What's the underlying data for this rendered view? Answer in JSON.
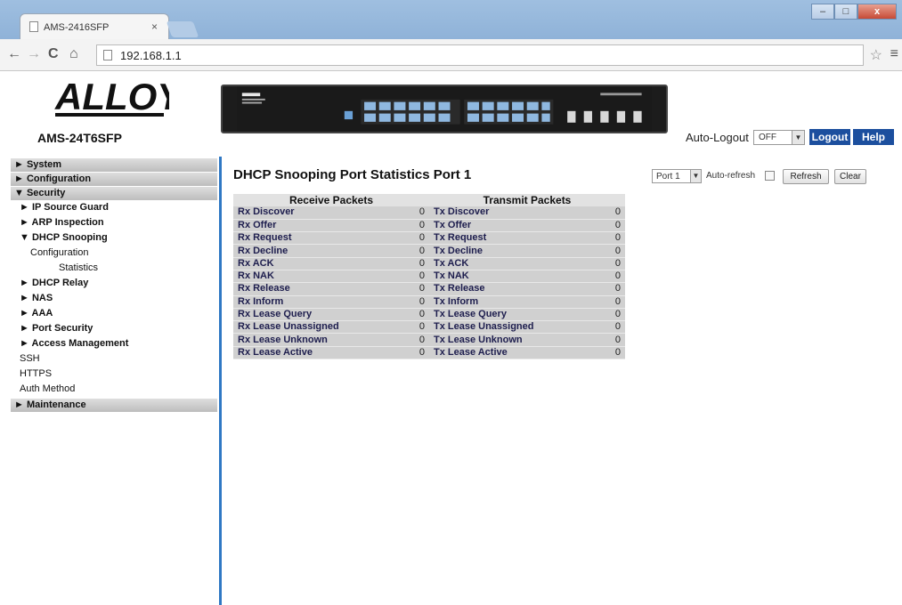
{
  "browser": {
    "tab_title": "AMS-2416SFP",
    "tab_close": "×",
    "address": "192.168.1.1",
    "nav_back": "←",
    "nav_forward": "→",
    "nav_reload": "C",
    "nav_home": "⌂",
    "star": "☆",
    "menu": "≡"
  },
  "header": {
    "logo_text": "ALLOY",
    "model": "AMS-24T6SFP",
    "auto_logout_label": "Auto-Logout",
    "auto_logout_value": "OFF",
    "logout_label": "Logout",
    "help_label": "Help"
  },
  "sidebar": {
    "system": "► System",
    "configuration": "► Configuration",
    "security": "▼ Security",
    "ip_source_guard": "► IP Source Guard",
    "arp_inspection": "► ARP Inspection",
    "dhcp_snooping": "▼ DHCP Snooping",
    "dhcp_configuration": "Configuration",
    "dhcp_statistics": "Statistics",
    "dhcp_relay": "► DHCP Relay",
    "nas": "► NAS",
    "aaa": "► AAA",
    "port_security": "► Port Security",
    "access_management": "► Access Management",
    "ssh": "SSH",
    "https": "HTTPS",
    "auth_method": "Auth Method",
    "maintenance": "► Maintenance"
  },
  "main": {
    "title": "DHCP Snooping Port Statistics  Port 1",
    "port_select": "Port 1",
    "auto_refresh_label": "Auto-refresh",
    "refresh_label": "Refresh",
    "clear_label": "Clear",
    "receive_header": "Receive Packets",
    "transmit_header": "Transmit Packets",
    "rows": [
      {
        "rx": "Rx Discover",
        "rxv": "0",
        "tx": "Tx Discover",
        "txv": "0"
      },
      {
        "rx": "Rx Offer",
        "rxv": "0",
        "tx": "Tx Offer",
        "txv": "0"
      },
      {
        "rx": "Rx Request",
        "rxv": "0",
        "tx": "Tx Request",
        "txv": "0"
      },
      {
        "rx": "Rx Decline",
        "rxv": "0",
        "tx": "Tx Decline",
        "txv": "0"
      },
      {
        "rx": "Rx ACK",
        "rxv": "0",
        "tx": "Tx ACK",
        "txv": "0"
      },
      {
        "rx": "Rx NAK",
        "rxv": "0",
        "tx": "Tx NAK",
        "txv": "0"
      },
      {
        "rx": "Rx Release",
        "rxv": "0",
        "tx": "Tx Release",
        "txv": "0"
      },
      {
        "rx": "Rx Inform",
        "rxv": "0",
        "tx": "Tx Inform",
        "txv": "0"
      },
      {
        "rx": "Rx Lease Query",
        "rxv": "0",
        "tx": "Tx Lease Query",
        "txv": "0"
      },
      {
        "rx": "Rx Lease Unassigned",
        "rxv": "0",
        "tx": "Tx Lease Unassigned",
        "txv": "0"
      },
      {
        "rx": "Rx Lease Unknown",
        "rxv": "0",
        "tx": "Tx Lease Unknown",
        "txv": "0"
      },
      {
        "rx": "Rx Lease Active",
        "rxv": "0",
        "tx": "Tx Lease Active",
        "txv": "0"
      }
    ]
  },
  "colors": {
    "accent_blue": "#1c4f9e",
    "sidebar_divider": "#2f78c4"
  }
}
